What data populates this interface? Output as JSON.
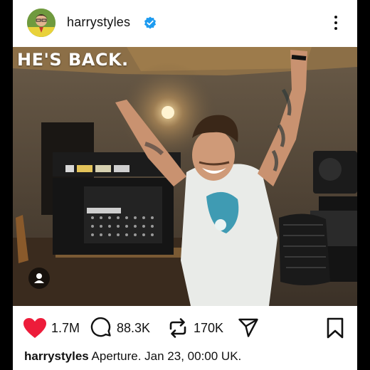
{
  "post": {
    "username": "harrystyles",
    "image_overlay_text": "HE'S BACK.",
    "likes": "1.7M",
    "comments": "88.3K",
    "reposts": "170K",
    "caption_user": "harrystyles",
    "caption_text": " Aperture. Jan 23, 00:00 UK."
  },
  "icons": {
    "verified": "verified-badge-icon",
    "more": "more-options-icon",
    "like": "heart-icon",
    "comment": "comment-icon",
    "repost": "repost-icon",
    "send": "send-icon",
    "save": "bookmark-icon",
    "tag": "user-tag-icon"
  },
  "colors": {
    "like_red": "#ed1c3a",
    "verified_blue": "#1d9bf0"
  }
}
